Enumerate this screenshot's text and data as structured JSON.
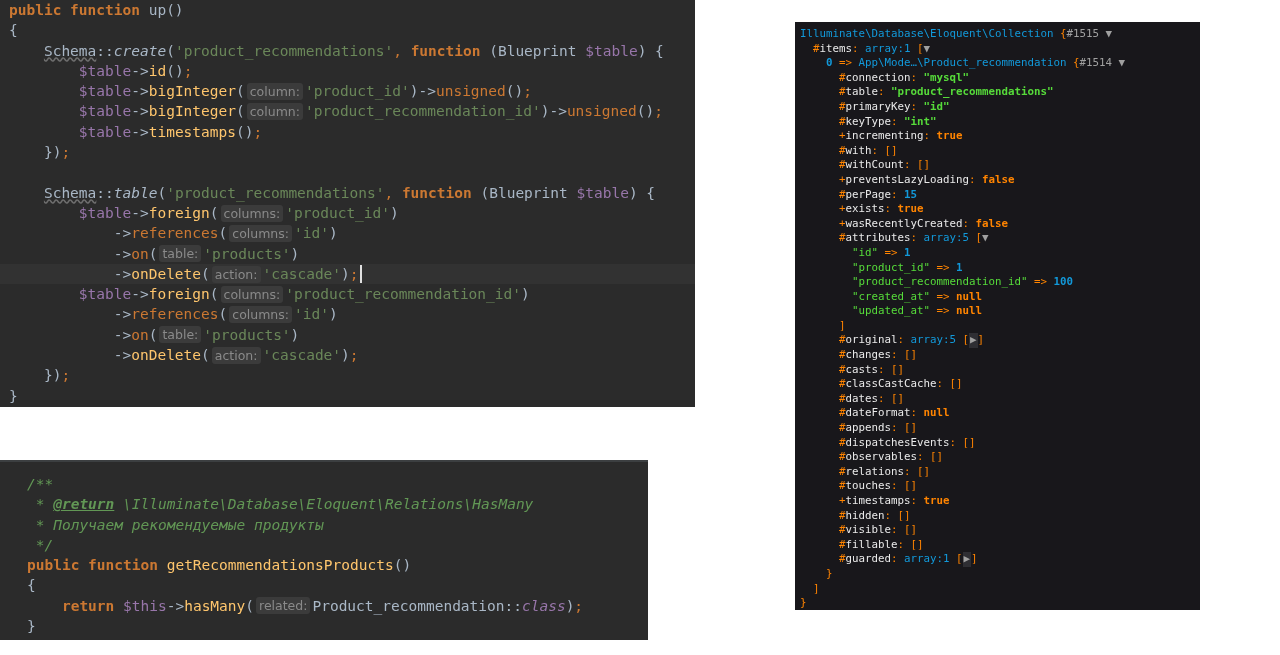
{
  "migration_editor": {
    "lines": [
      {
        "current": false,
        "tokens": [
          {
            "kind": "kw",
            "text": "public function"
          },
          {
            "kind": "plain",
            "text": " up()"
          }
        ]
      },
      {
        "current": false,
        "tokens": [
          {
            "kind": "plain",
            "text": "{"
          }
        ]
      },
      {
        "current": false,
        "tokens": [
          {
            "kind": "cls",
            "text": "    Schema"
          },
          {
            "kind": "plain",
            "text": "::"
          },
          {
            "kind": "ital",
            "text": "create"
          },
          {
            "kind": "plain",
            "text": "("
          },
          {
            "kind": "str",
            "text": "'product_recommendations'"
          },
          {
            "kind": "punct",
            "text": ", "
          },
          {
            "kind": "kw",
            "text": "function"
          },
          {
            "kind": "plain",
            "text": " (Blueprint "
          },
          {
            "kind": "var",
            "text": "$table"
          },
          {
            "kind": "plain",
            "text": ") {"
          }
        ]
      },
      {
        "current": false,
        "tokens": [
          {
            "kind": "var",
            "text": "        $table"
          },
          {
            "kind": "plain",
            "text": "->"
          },
          {
            "kind": "fn",
            "text": "id"
          },
          {
            "kind": "plain",
            "text": "()"
          },
          {
            "kind": "punct",
            "text": ";"
          }
        ]
      },
      {
        "current": false,
        "tokens": [
          {
            "kind": "var",
            "text": "        $table"
          },
          {
            "kind": "plain",
            "text": "->"
          },
          {
            "kind": "fn",
            "text": "bigInteger"
          },
          {
            "kind": "plain",
            "text": "("
          },
          {
            "kind": "hint",
            "text": "column:"
          },
          {
            "kind": "str",
            "text": "'product_id'"
          },
          {
            "kind": "plain",
            "text": ")->"
          },
          {
            "kind": "meth",
            "text": "unsigned"
          },
          {
            "kind": "plain",
            "text": "()"
          },
          {
            "kind": "punct",
            "text": ";"
          }
        ]
      },
      {
        "current": false,
        "tokens": [
          {
            "kind": "var",
            "text": "        $table"
          },
          {
            "kind": "plain",
            "text": "->"
          },
          {
            "kind": "fn",
            "text": "bigInteger"
          },
          {
            "kind": "plain",
            "text": "("
          },
          {
            "kind": "hint",
            "text": "column:"
          },
          {
            "kind": "str",
            "text": "'product_recommendation_id'"
          },
          {
            "kind": "plain",
            "text": ")->"
          },
          {
            "kind": "meth",
            "text": "unsigned"
          },
          {
            "kind": "plain",
            "text": "()"
          },
          {
            "kind": "punct",
            "text": ";"
          }
        ]
      },
      {
        "current": false,
        "tokens": [
          {
            "kind": "var",
            "text": "        $table"
          },
          {
            "kind": "plain",
            "text": "->"
          },
          {
            "kind": "fn",
            "text": "timestamps"
          },
          {
            "kind": "plain",
            "text": "()"
          },
          {
            "kind": "punct",
            "text": ";"
          }
        ]
      },
      {
        "current": false,
        "tokens": [
          {
            "kind": "plain",
            "text": "    })"
          },
          {
            "kind": "punct",
            "text": ";"
          }
        ]
      },
      {
        "current": false
      },
      {
        "current": false,
        "tokens": [
          {
            "kind": "cls",
            "text": "    Schema"
          },
          {
            "kind": "plain",
            "text": "::"
          },
          {
            "kind": "ital",
            "text": "table"
          },
          {
            "kind": "plain",
            "text": "("
          },
          {
            "kind": "str",
            "text": "'product_recommendations'"
          },
          {
            "kind": "punct",
            "text": ", "
          },
          {
            "kind": "kw",
            "text": "function"
          },
          {
            "kind": "plain",
            "text": " (Blueprint "
          },
          {
            "kind": "var",
            "text": "$table"
          },
          {
            "kind": "plain",
            "text": ") {"
          }
        ]
      },
      {
        "current": false,
        "tokens": [
          {
            "kind": "var",
            "text": "        $table"
          },
          {
            "kind": "plain",
            "text": "->"
          },
          {
            "kind": "fn",
            "text": "foreign"
          },
          {
            "kind": "plain",
            "text": "("
          },
          {
            "kind": "hint",
            "text": "columns:"
          },
          {
            "kind": "str",
            "text": "'product_id'"
          },
          {
            "kind": "plain",
            "text": ")"
          }
        ]
      },
      {
        "current": false,
        "tokens": [
          {
            "kind": "plain",
            "text": "            ->"
          },
          {
            "kind": "meth",
            "text": "references"
          },
          {
            "kind": "plain",
            "text": "("
          },
          {
            "kind": "hint",
            "text": "columns:"
          },
          {
            "kind": "str",
            "text": "'id'"
          },
          {
            "kind": "plain",
            "text": ")"
          }
        ]
      },
      {
        "current": false,
        "tokens": [
          {
            "kind": "plain",
            "text": "            ->"
          },
          {
            "kind": "meth",
            "text": "on"
          },
          {
            "kind": "plain",
            "text": "("
          },
          {
            "kind": "hint",
            "text": "table:"
          },
          {
            "kind": "str",
            "text": "'products'"
          },
          {
            "kind": "plain",
            "text": ")"
          }
        ]
      },
      {
        "current": true,
        "tokens": [
          {
            "kind": "plain",
            "text": "            ->"
          },
          {
            "kind": "fn",
            "text": "onDelete"
          },
          {
            "kind": "plain",
            "text": "("
          },
          {
            "kind": "hint",
            "text": "action:"
          },
          {
            "kind": "str",
            "text": "'cascade'"
          },
          {
            "kind": "plain",
            "text": ")"
          },
          {
            "kind": "punct",
            "text": ";"
          }
        ]
      },
      {
        "current": false,
        "tokens": [
          {
            "kind": "var",
            "text": "        $table"
          },
          {
            "kind": "plain",
            "text": "->"
          },
          {
            "kind": "fn",
            "text": "foreign"
          },
          {
            "kind": "plain",
            "text": "("
          },
          {
            "kind": "hint",
            "text": "columns:"
          },
          {
            "kind": "str",
            "text": "'product_recommendation_id'"
          },
          {
            "kind": "plain",
            "text": ")"
          }
        ]
      },
      {
        "current": false,
        "tokens": [
          {
            "kind": "plain",
            "text": "            ->"
          },
          {
            "kind": "meth",
            "text": "references"
          },
          {
            "kind": "plain",
            "text": "("
          },
          {
            "kind": "hint",
            "text": "columns:"
          },
          {
            "kind": "str",
            "text": "'id'"
          },
          {
            "kind": "plain",
            "text": ")"
          }
        ]
      },
      {
        "current": false,
        "tokens": [
          {
            "kind": "plain",
            "text": "            ->"
          },
          {
            "kind": "meth",
            "text": "on"
          },
          {
            "kind": "plain",
            "text": "("
          },
          {
            "kind": "hint",
            "text": "table:"
          },
          {
            "kind": "str",
            "text": "'products'"
          },
          {
            "kind": "plain",
            "text": ")"
          }
        ]
      },
      {
        "current": false,
        "tokens": [
          {
            "kind": "plain",
            "text": "            ->"
          },
          {
            "kind": "fn",
            "text": "onDelete"
          },
          {
            "kind": "plain",
            "text": "("
          },
          {
            "kind": "hint",
            "text": "action:"
          },
          {
            "kind": "str",
            "text": "'cascade'"
          },
          {
            "kind": "plain",
            "text": ")"
          },
          {
            "kind": "punct",
            "text": ";"
          }
        ]
      },
      {
        "current": false,
        "tokens": [
          {
            "kind": "plain",
            "text": "    })"
          },
          {
            "kind": "punct",
            "text": ";"
          }
        ]
      },
      {
        "current": false,
        "tokens": [
          {
            "kind": "plain",
            "text": "}"
          }
        ]
      }
    ]
  },
  "model_editor": {
    "lines": [
      {
        "current": false,
        "tokens": [
          {
            "kind": "comment",
            "text": "/**"
          }
        ]
      },
      {
        "current": false,
        "tokens": [
          {
            "kind": "comment",
            "text": " * "
          },
          {
            "kind": "doctag",
            "text": "@return"
          },
          {
            "kind": "comment",
            "text": " \\Illuminate\\Database\\Eloquent\\Relations\\HasMany"
          }
        ]
      },
      {
        "current": false,
        "tokens": [
          {
            "kind": "comment",
            "text": " * Получаем рекомендуемые продукты"
          }
        ]
      },
      {
        "current": false,
        "tokens": [
          {
            "kind": "comment",
            "text": " */"
          }
        ]
      },
      {
        "current": false,
        "tokens": [
          {
            "kind": "kw",
            "text": "public function"
          },
          {
            "kind": "fn",
            "text": " getRecommendationsProducts"
          },
          {
            "kind": "plain",
            "text": "()"
          }
        ]
      },
      {
        "current": false,
        "tokens": [
          {
            "kind": "plain",
            "text": "{"
          }
        ]
      },
      {
        "current": false,
        "tokens": [
          {
            "kind": "kw",
            "text": "    return"
          },
          {
            "kind": "var",
            "text": " $this"
          },
          {
            "kind": "plain",
            "text": "->"
          },
          {
            "kind": "fn",
            "text": "hasMany"
          },
          {
            "kind": "plain",
            "text": "("
          },
          {
            "kind": "hint",
            "text": "related:"
          },
          {
            "kind": "plain",
            "text": "Product_recommendation::"
          },
          {
            "kind": "kwital",
            "text": "class"
          },
          {
            "kind": "plain",
            "text": ")"
          },
          {
            "kind": "punct",
            "text": ";"
          }
        ]
      },
      {
        "current": false,
        "tokens": [
          {
            "kind": "plain",
            "text": "}"
          }
        ]
      }
    ]
  },
  "dump": {
    "lines": [
      {
        "tokens": [
          {
            "kind": "dcls",
            "text": "Illuminate\\Database\\Eloquent\\Collection"
          },
          {
            "kind": "dpunct",
            "text": " {"
          },
          {
            "kind": "dref",
            "text": "#1515 ▼"
          }
        ]
      },
      {
        "tokens": [
          {
            "kind": "dpunct",
            "text": "  #"
          },
          {
            "kind": "dkey",
            "text": "items"
          },
          {
            "kind": "dpunct",
            "text": ": "
          },
          {
            "kind": "dnote",
            "text": "array:1"
          },
          {
            "kind": "dpunct",
            "text": " ["
          },
          {
            "kind": "dref",
            "text": "▼"
          }
        ]
      },
      {
        "tokens": [
          {
            "kind": "dnum",
            "text": "    0"
          },
          {
            "kind": "dpunct",
            "text": " => "
          },
          {
            "kind": "dcls",
            "text": "App\\Mode…\\Product_recommendation"
          },
          {
            "kind": "dpunct",
            "text": " {"
          },
          {
            "kind": "dref",
            "text": "#1514 ▼"
          }
        ]
      },
      {
        "tokens": [
          {
            "kind": "dpunct",
            "text": "      #"
          },
          {
            "kind": "dkey",
            "text": "connection"
          },
          {
            "kind": "dpunct",
            "text": ": "
          },
          {
            "kind": "dstr",
            "text": "\"mysql\""
          }
        ]
      },
      {
        "tokens": [
          {
            "kind": "dpunct",
            "text": "      #"
          },
          {
            "kind": "dkey",
            "text": "table"
          },
          {
            "kind": "dpunct",
            "text": ": "
          },
          {
            "kind": "dstr",
            "text": "\"product_recommendations\""
          }
        ]
      },
      {
        "tokens": [
          {
            "kind": "dpunct",
            "text": "      #"
          },
          {
            "kind": "dkey",
            "text": "primaryKey"
          },
          {
            "kind": "dpunct",
            "text": ": "
          },
          {
            "kind": "dstr",
            "text": "\"id\""
          }
        ]
      },
      {
        "tokens": [
          {
            "kind": "dpunct",
            "text": "      #"
          },
          {
            "kind": "dkey",
            "text": "keyType"
          },
          {
            "kind": "dpunct",
            "text": ": "
          },
          {
            "kind": "dstr",
            "text": "\"int\""
          }
        ]
      },
      {
        "tokens": [
          {
            "kind": "dpunct",
            "text": "      +"
          },
          {
            "kind": "dkey",
            "text": "incrementing"
          },
          {
            "kind": "dpunct",
            "text": ": "
          },
          {
            "kind": "dconst",
            "text": "true"
          }
        ]
      },
      {
        "tokens": [
          {
            "kind": "dpunct",
            "text": "      #"
          },
          {
            "kind": "dkey",
            "text": "with"
          },
          {
            "kind": "dpunct",
            "text": ": []"
          }
        ]
      },
      {
        "tokens": [
          {
            "kind": "dpunct",
            "text": "      #"
          },
          {
            "kind": "dkey",
            "text": "withCount"
          },
          {
            "kind": "dpunct",
            "text": ": []"
          }
        ]
      },
      {
        "tokens": [
          {
            "kind": "dpunct",
            "text": "      +"
          },
          {
            "kind": "dkey",
            "text": "preventsLazyLoading"
          },
          {
            "kind": "dpunct",
            "text": ": "
          },
          {
            "kind": "dconst",
            "text": "false"
          }
        ]
      },
      {
        "tokens": [
          {
            "kind": "dpunct",
            "text": "      #"
          },
          {
            "kind": "dkey",
            "text": "perPage"
          },
          {
            "kind": "dpunct",
            "text": ": "
          },
          {
            "kind": "dnum",
            "text": "15"
          }
        ]
      },
      {
        "tokens": [
          {
            "kind": "dpunct",
            "text": "      +"
          },
          {
            "kind": "dkey",
            "text": "exists"
          },
          {
            "kind": "dpunct",
            "text": ": "
          },
          {
            "kind": "dconst",
            "text": "true"
          }
        ]
      },
      {
        "tokens": [
          {
            "kind": "dpunct",
            "text": "      +"
          },
          {
            "kind": "dkey",
            "text": "wasRecentlyCreated"
          },
          {
            "kind": "dpunct",
            "text": ": "
          },
          {
            "kind": "dconst",
            "text": "false"
          }
        ]
      },
      {
        "tokens": [
          {
            "kind": "dpunct",
            "text": "      #"
          },
          {
            "kind": "dkey",
            "text": "attributes"
          },
          {
            "kind": "dpunct",
            "text": ": "
          },
          {
            "kind": "dnote",
            "text": "array:5"
          },
          {
            "kind": "dpunct",
            "text": " ["
          },
          {
            "kind": "dref",
            "text": "▼"
          }
        ]
      },
      {
        "tokens": [
          {
            "kind": "dstr2",
            "text": "        \"id\""
          },
          {
            "kind": "dpunct",
            "text": " => "
          },
          {
            "kind": "dnum",
            "text": "1"
          }
        ]
      },
      {
        "tokens": [
          {
            "kind": "dstr2",
            "text": "        \"product_id\""
          },
          {
            "kind": "dpunct",
            "text": " => "
          },
          {
            "kind": "dnum",
            "text": "1"
          }
        ]
      },
      {
        "tokens": [
          {
            "kind": "dstr2",
            "text": "        \"product_recommendation_id\""
          },
          {
            "kind": "dpunct",
            "text": " => "
          },
          {
            "kind": "dnum",
            "text": "100"
          }
        ]
      },
      {
        "tokens": [
          {
            "kind": "dstr2",
            "text": "        \"created_at\""
          },
          {
            "kind": "dpunct",
            "text": " => "
          },
          {
            "kind": "dconst",
            "text": "null"
          }
        ]
      },
      {
        "tokens": [
          {
            "kind": "dstr2",
            "text": "        \"updated_at\""
          },
          {
            "kind": "dpunct",
            "text": " => "
          },
          {
            "kind": "dconst",
            "text": "null"
          }
        ]
      },
      {
        "tokens": [
          {
            "kind": "dpunct",
            "text": "      ]"
          }
        ]
      },
      {
        "tokens": [
          {
            "kind": "dpunct",
            "text": "      #"
          },
          {
            "kind": "dkey",
            "text": "original"
          },
          {
            "kind": "dpunct",
            "text": ": "
          },
          {
            "kind": "dnote",
            "text": "array:5"
          },
          {
            "kind": "dpunct",
            "text": " ["
          },
          {
            "kind": "expander",
            "text": "▶"
          },
          {
            "kind": "dpunct",
            "text": "]"
          }
        ]
      },
      {
        "tokens": [
          {
            "kind": "dpunct",
            "text": "      #"
          },
          {
            "kind": "dkey",
            "text": "changes"
          },
          {
            "kind": "dpunct",
            "text": ": []"
          }
        ]
      },
      {
        "tokens": [
          {
            "kind": "dpunct",
            "text": "      #"
          },
          {
            "kind": "dkey",
            "text": "casts"
          },
          {
            "kind": "dpunct",
            "text": ": []"
          }
        ]
      },
      {
        "tokens": [
          {
            "kind": "dpunct",
            "text": "      #"
          },
          {
            "kind": "dkey",
            "text": "classCastCache"
          },
          {
            "kind": "dpunct",
            "text": ": []"
          }
        ]
      },
      {
        "tokens": [
          {
            "kind": "dpunct",
            "text": "      #"
          },
          {
            "kind": "dkey",
            "text": "dates"
          },
          {
            "kind": "dpunct",
            "text": ": []"
          }
        ]
      },
      {
        "tokens": [
          {
            "kind": "dpunct",
            "text": "      #"
          },
          {
            "kind": "dkey",
            "text": "dateFormat"
          },
          {
            "kind": "dpunct",
            "text": ": "
          },
          {
            "kind": "dconst",
            "text": "null"
          }
        ]
      },
      {
        "tokens": [
          {
            "kind": "dpunct",
            "text": "      #"
          },
          {
            "kind": "dkey",
            "text": "appends"
          },
          {
            "kind": "dpunct",
            "text": ": []"
          }
        ]
      },
      {
        "tokens": [
          {
            "kind": "dpunct",
            "text": "      #"
          },
          {
            "kind": "dkey",
            "text": "dispatchesEvents"
          },
          {
            "kind": "dpunct",
            "text": ": []"
          }
        ]
      },
      {
        "tokens": [
          {
            "kind": "dpunct",
            "text": "      #"
          },
          {
            "kind": "dkey",
            "text": "observables"
          },
          {
            "kind": "dpunct",
            "text": ": []"
          }
        ]
      },
      {
        "tokens": [
          {
            "kind": "dpunct",
            "text": "      #"
          },
          {
            "kind": "dkey",
            "text": "relations"
          },
          {
            "kind": "dpunct",
            "text": ": []"
          }
        ]
      },
      {
        "tokens": [
          {
            "kind": "dpunct",
            "text": "      #"
          },
          {
            "kind": "dkey",
            "text": "touches"
          },
          {
            "kind": "dpunct",
            "text": ": []"
          }
        ]
      },
      {
        "tokens": [
          {
            "kind": "dpunct",
            "text": "      +"
          },
          {
            "kind": "dkey",
            "text": "timestamps"
          },
          {
            "kind": "dpunct",
            "text": ": "
          },
          {
            "kind": "dconst",
            "text": "true"
          }
        ]
      },
      {
        "tokens": [
          {
            "kind": "dpunct",
            "text": "      #"
          },
          {
            "kind": "dkey",
            "text": "hidden"
          },
          {
            "kind": "dpunct",
            "text": ": []"
          }
        ]
      },
      {
        "tokens": [
          {
            "kind": "dpunct",
            "text": "      #"
          },
          {
            "kind": "dkey",
            "text": "visible"
          },
          {
            "kind": "dpunct",
            "text": ": []"
          }
        ]
      },
      {
        "tokens": [
          {
            "kind": "dpunct",
            "text": "      #"
          },
          {
            "kind": "dkey",
            "text": "fillable"
          },
          {
            "kind": "dpunct",
            "text": ": []"
          }
        ]
      },
      {
        "tokens": [
          {
            "kind": "dpunct",
            "text": "      #"
          },
          {
            "kind": "dkey",
            "text": "guarded"
          },
          {
            "kind": "dpunct",
            "text": ": "
          },
          {
            "kind": "dnote",
            "text": "array:1"
          },
          {
            "kind": "dpunct",
            "text": " ["
          },
          {
            "kind": "expander",
            "text": "▶"
          },
          {
            "kind": "dpunct",
            "text": "]"
          }
        ]
      },
      {
        "tokens": [
          {
            "kind": "dpunct",
            "text": "    }"
          }
        ]
      },
      {
        "tokens": [
          {
            "kind": "dpunct",
            "text": "  ]"
          }
        ]
      },
      {
        "tokens": [
          {
            "kind": "dpunct",
            "text": "}"
          }
        ]
      }
    ]
  }
}
